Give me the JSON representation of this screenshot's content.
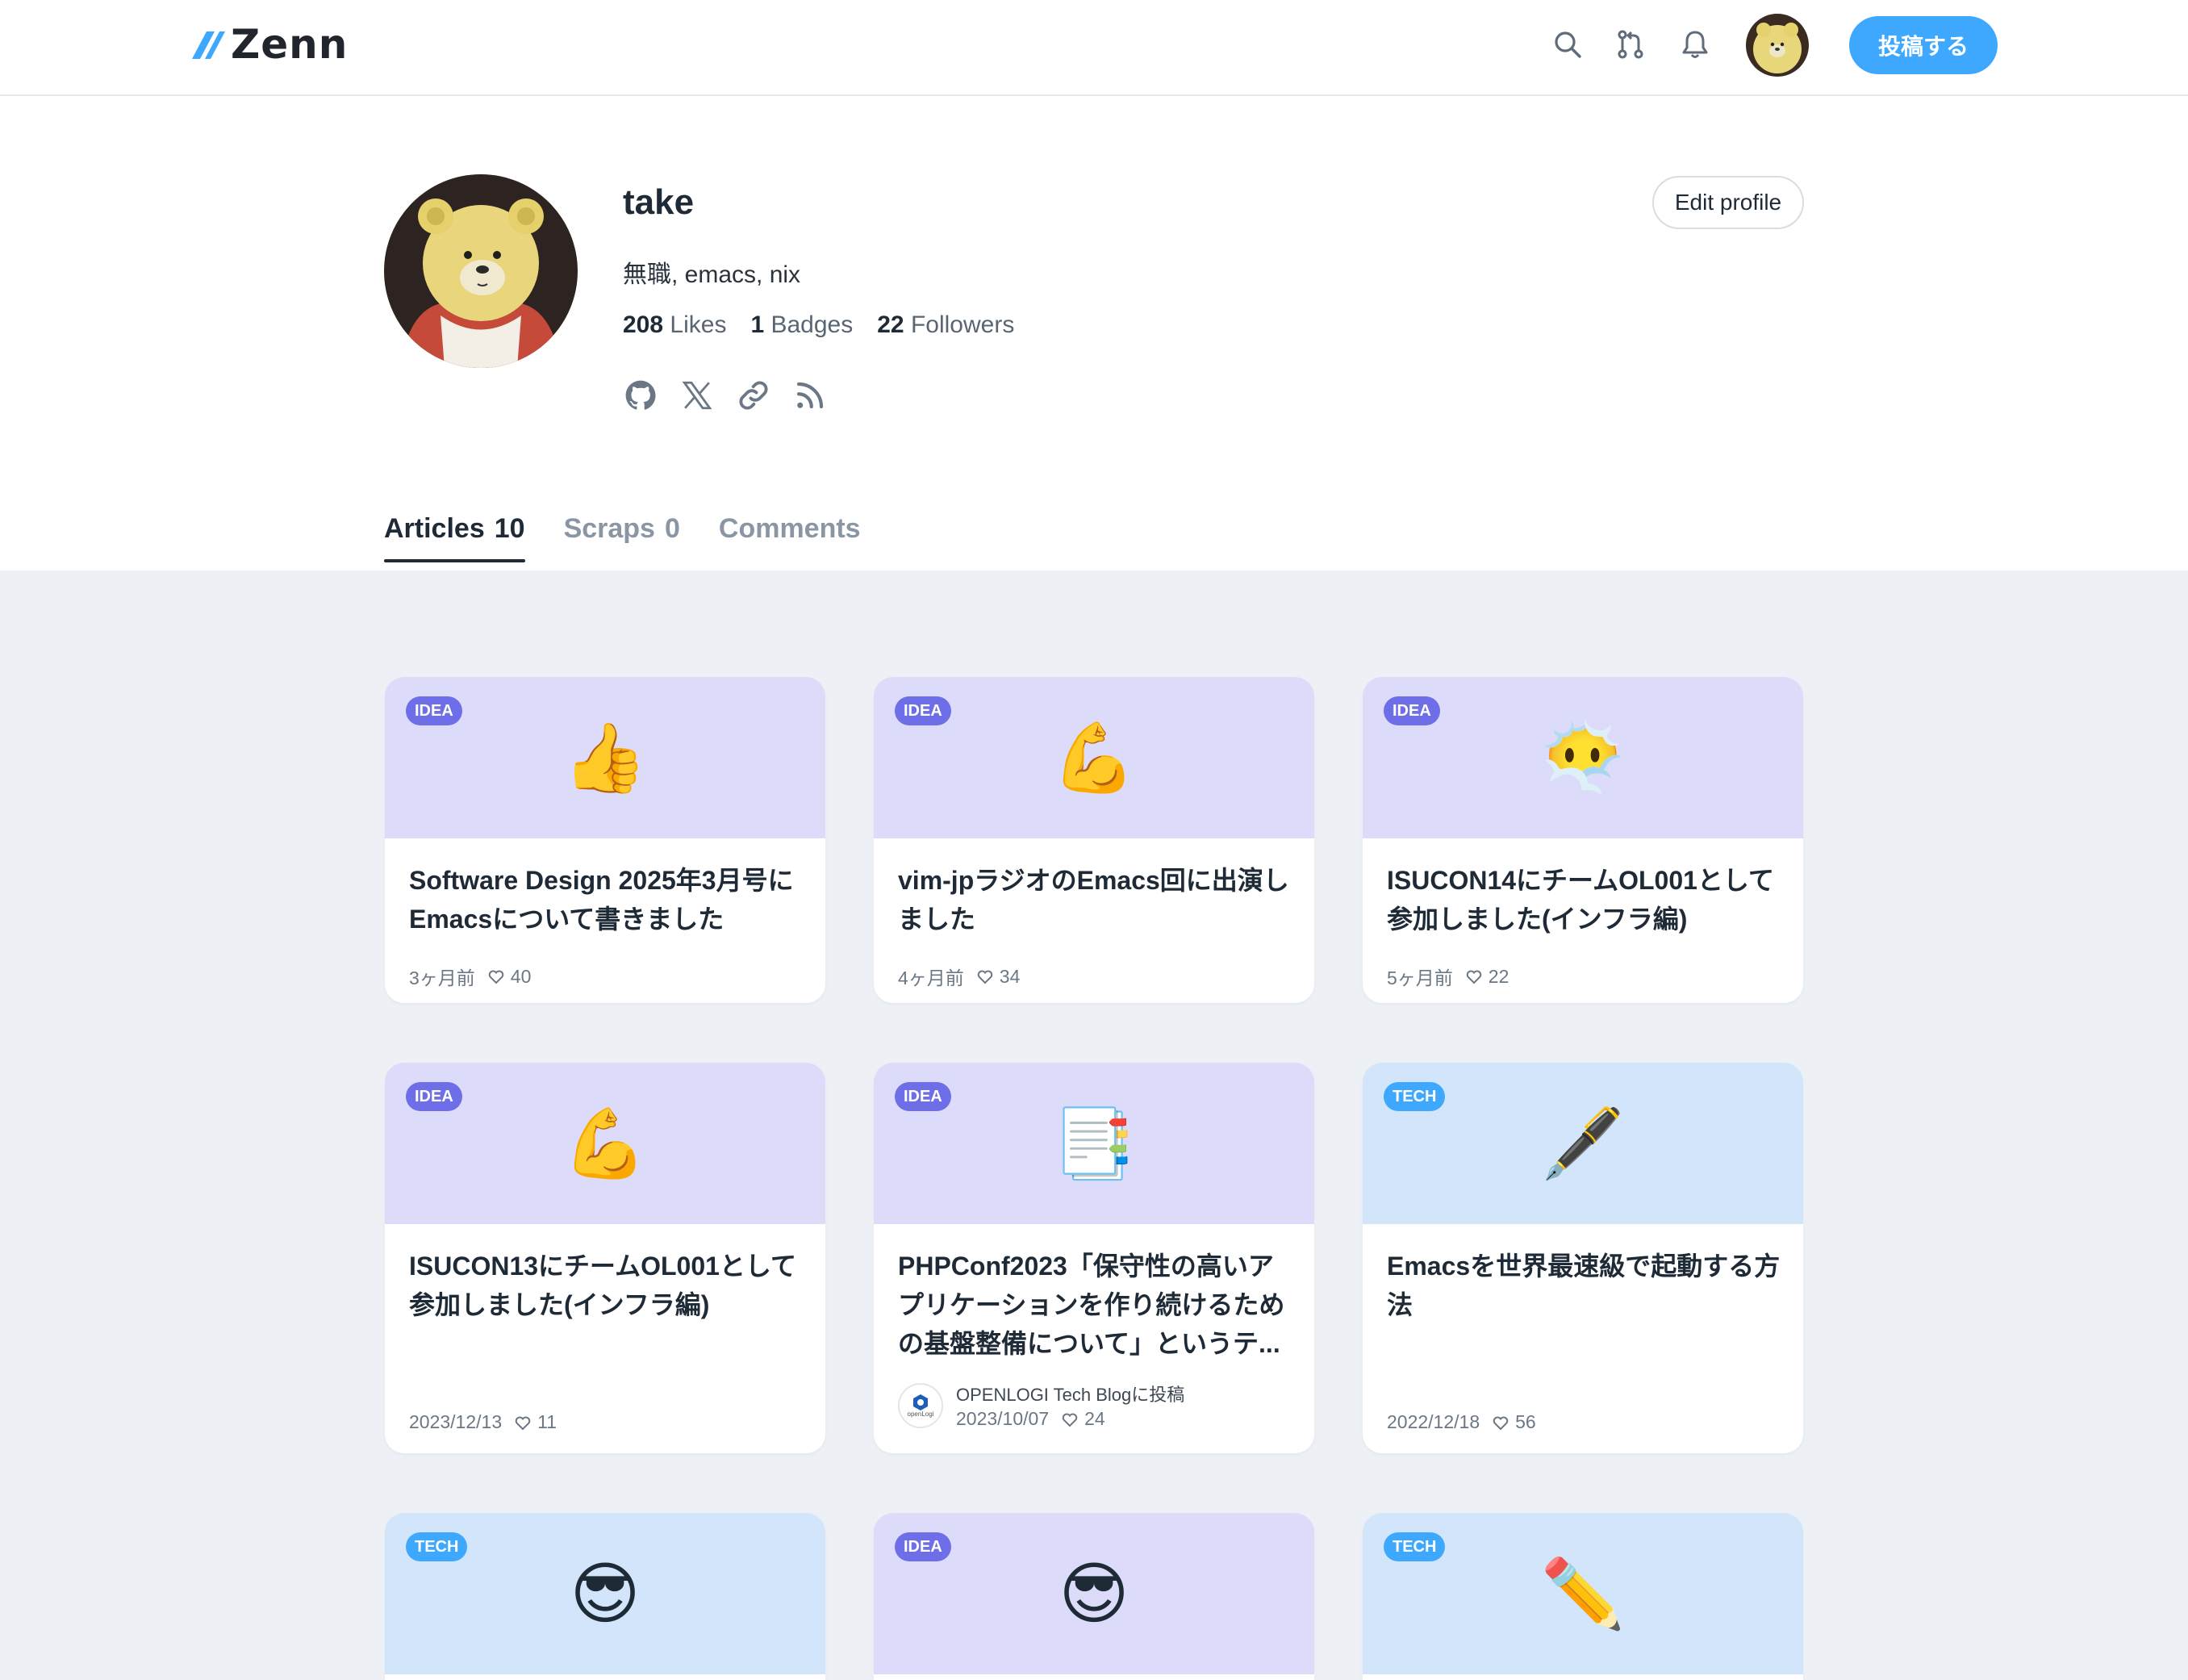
{
  "brand": {
    "logo_text": "Zenn",
    "accent": "#3ea8ff"
  },
  "header": {
    "icons": [
      "search-icon",
      "git-pull-request-icon",
      "bell-icon"
    ],
    "post_button": "投稿する"
  },
  "profile": {
    "name": "take",
    "bio": "無職, emacs, nix",
    "stats": [
      {
        "value": "208",
        "label": "Likes"
      },
      {
        "value": "1",
        "label": "Badges"
      },
      {
        "value": "22",
        "label": "Followers"
      }
    ],
    "socials": [
      "github-icon",
      "x-icon",
      "link-icon",
      "rss-icon"
    ],
    "edit_button": "Edit profile"
  },
  "tabs": [
    {
      "label": "Articles",
      "count": "10",
      "active": true
    },
    {
      "label": "Scraps",
      "count": "0",
      "active": false
    },
    {
      "label": "Comments",
      "count": "",
      "active": false
    }
  ],
  "articles": [
    {
      "type": "IDEA",
      "emoji": "👍",
      "title": "Software Design 2025年3月号にEmacsについて書きました",
      "date": "3ヶ月前",
      "likes": "40"
    },
    {
      "type": "IDEA",
      "emoji": "💪",
      "title": "vim-jpラジオのEmacs回に出演しました",
      "date": "4ヶ月前",
      "likes": "34"
    },
    {
      "type": "IDEA",
      "emoji": "😶‍🌫️",
      "title": "ISUCON14にチームOL001として参加しました(インフラ編)",
      "date": "5ヶ月前",
      "likes": "22"
    },
    {
      "type": "IDEA",
      "emoji": "💪",
      "title": "ISUCON13にチームOL001として参加しました(インフラ編)",
      "date": "2023/12/13",
      "likes": "11"
    },
    {
      "type": "IDEA",
      "emoji": "📑",
      "title": "PHPConf2023「保守性の高いアプリケーションを作り続けるための基盤整備について」というテ...",
      "date": "2023/10/07",
      "likes": "24",
      "publication": "OPENLOGI Tech Blogに投稿",
      "publication_logo": "openLogi"
    },
    {
      "type": "TECH",
      "emoji": "🖋️",
      "title": "Emacsを世界最速級で起動する方法",
      "date": "2022/12/18",
      "likes": "56"
    },
    {
      "type": "TECH",
      "emoji": "😎",
      "title": "",
      "date": "",
      "likes": ""
    },
    {
      "type": "IDEA",
      "emoji": "😎",
      "title": "",
      "date": "",
      "likes": ""
    },
    {
      "type": "TECH",
      "emoji": "✏️",
      "title": "",
      "date": "",
      "likes": ""
    }
  ]
}
